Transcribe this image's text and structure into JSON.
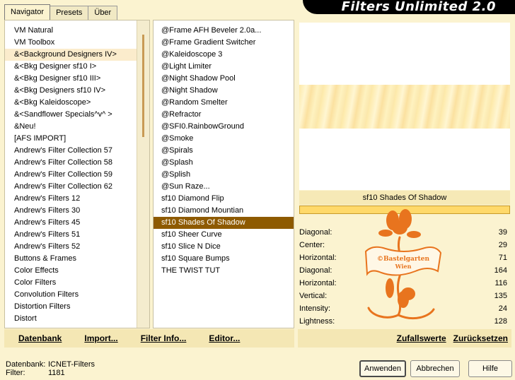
{
  "app": {
    "title": "Filters Unlimited 2.0"
  },
  "tabs": [
    {
      "label": "Navigator",
      "active": true
    },
    {
      "label": "Presets",
      "active": false
    },
    {
      "label": "Über",
      "active": false
    }
  ],
  "categories": [
    "VM Natural",
    "VM Toolbox",
    "&<Background Designers IV>",
    "&<Bkg Designer sf10 I>",
    "&<Bkg Designer sf10 III>",
    "&<Bkg Designers sf10 IV>",
    "&<Bkg Kaleidoscope>",
    "&<Sandflower Specials^v^ >",
    "&Neu!",
    "[AFS IMPORT]",
    "Andrew's Filter Collection 57",
    "Andrew's Filter Collection 58",
    "Andrew's Filter Collection 59",
    "Andrew's Filter Collection 62",
    "Andrew's Filters 12",
    "Andrew's Filters 30",
    "Andrew's Filters 45",
    "Andrew's Filters 51",
    "Andrew's Filters 52",
    "Buttons & Frames",
    "Color Effects",
    "Color Filters",
    "Convolution Filters",
    "Distortion Filters",
    "Distort"
  ],
  "categories_selected": 2,
  "filters": [
    "@Frame AFH Beveler 2.0a...",
    "@Frame Gradient Switcher",
    "@Kaleidoscope 3",
    "@Light Limiter",
    "@Night Shadow Pool",
    "@Night Shadow",
    "@Random Smelter",
    "@Refractor",
    "@SFI0.RainbowGround",
    "@Smoke",
    "@Spirals",
    "@Splash",
    "@Splish",
    "@Sun Raze...",
    "sf10 Diamond Flip",
    "sf10 Diamond Mountian",
    "sf10 Shades Of Shadow",
    "sf10 Sheer Curve",
    "sf10 Slice N Dice",
    "sf10 Square Bumps",
    "THE TWIST TUT"
  ],
  "filters_selected": 16,
  "filter_title": "sf10 Shades Of Shadow",
  "params": [
    {
      "label": "Diagonal:",
      "value": "39"
    },
    {
      "label": "Center:",
      "value": "29"
    },
    {
      "label": "Horizontal:",
      "value": "71"
    },
    {
      "label": "Diagonal:",
      "value": "164"
    },
    {
      "label": "Horizontal:",
      "value": "116"
    },
    {
      "label": "Vertical:",
      "value": "135"
    },
    {
      "label": "Intensity:",
      "value": "24"
    },
    {
      "label": "Lightness:",
      "value": "128"
    }
  ],
  "watermark": {
    "line1": "©Bastelgarten",
    "line2": "Wien"
  },
  "bottom_left_buttons": [
    {
      "label": "Datenbank"
    },
    {
      "label": "Import..."
    },
    {
      "label": "Filter Info..."
    },
    {
      "label": "Editor..."
    }
  ],
  "bottom_right_buttons": [
    {
      "label": "Zufallswerte"
    },
    {
      "label": "Zurücksetzen"
    }
  ],
  "status": {
    "db_label": "Datenbank:",
    "db_value": "ICNET-Filters",
    "filter_label": "Filter:",
    "filter_value": "1181"
  },
  "dialog_buttons": {
    "apply": "Anwenden",
    "cancel": "Abbrechen",
    "help": "Hilfe"
  },
  "colors": {
    "background": "#fbf3d0",
    "selection": "#8e5a00",
    "accent": "#ffd96a",
    "logo": "#e8741e"
  }
}
